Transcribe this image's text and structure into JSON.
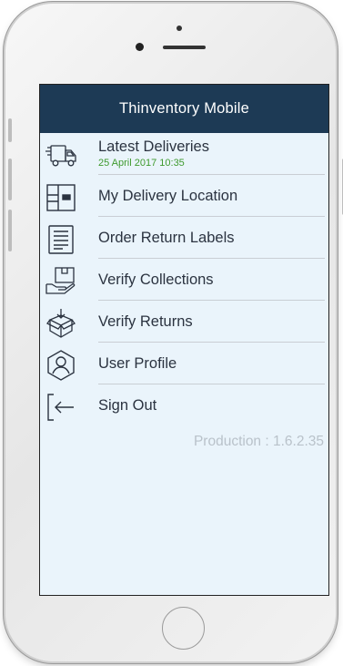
{
  "app": {
    "title": "Thinventory Mobile"
  },
  "menu": [
    {
      "label": "Latest Deliveries",
      "subtitle": "25 April 2017 10:35",
      "icon": "delivery-truck-icon"
    },
    {
      "label": "My Delivery Location",
      "icon": "location-layout-icon"
    },
    {
      "label": "Order Return Labels",
      "icon": "document-lines-icon"
    },
    {
      "label": "Verify Collections",
      "icon": "hand-box-icon"
    },
    {
      "label": "Verify Returns",
      "icon": "box-return-icon"
    },
    {
      "label": "User Profile",
      "icon": "user-profile-icon"
    },
    {
      "label": "Sign Out",
      "icon": "sign-out-icon"
    }
  ],
  "footer": {
    "version": "Production : 1.6.2.35"
  },
  "colors": {
    "header_bg": "#1d3a55",
    "screen_bg": "#eaf4fb",
    "subtitle_green": "#3f9a2e",
    "version_grey": "#b9c2ca"
  }
}
